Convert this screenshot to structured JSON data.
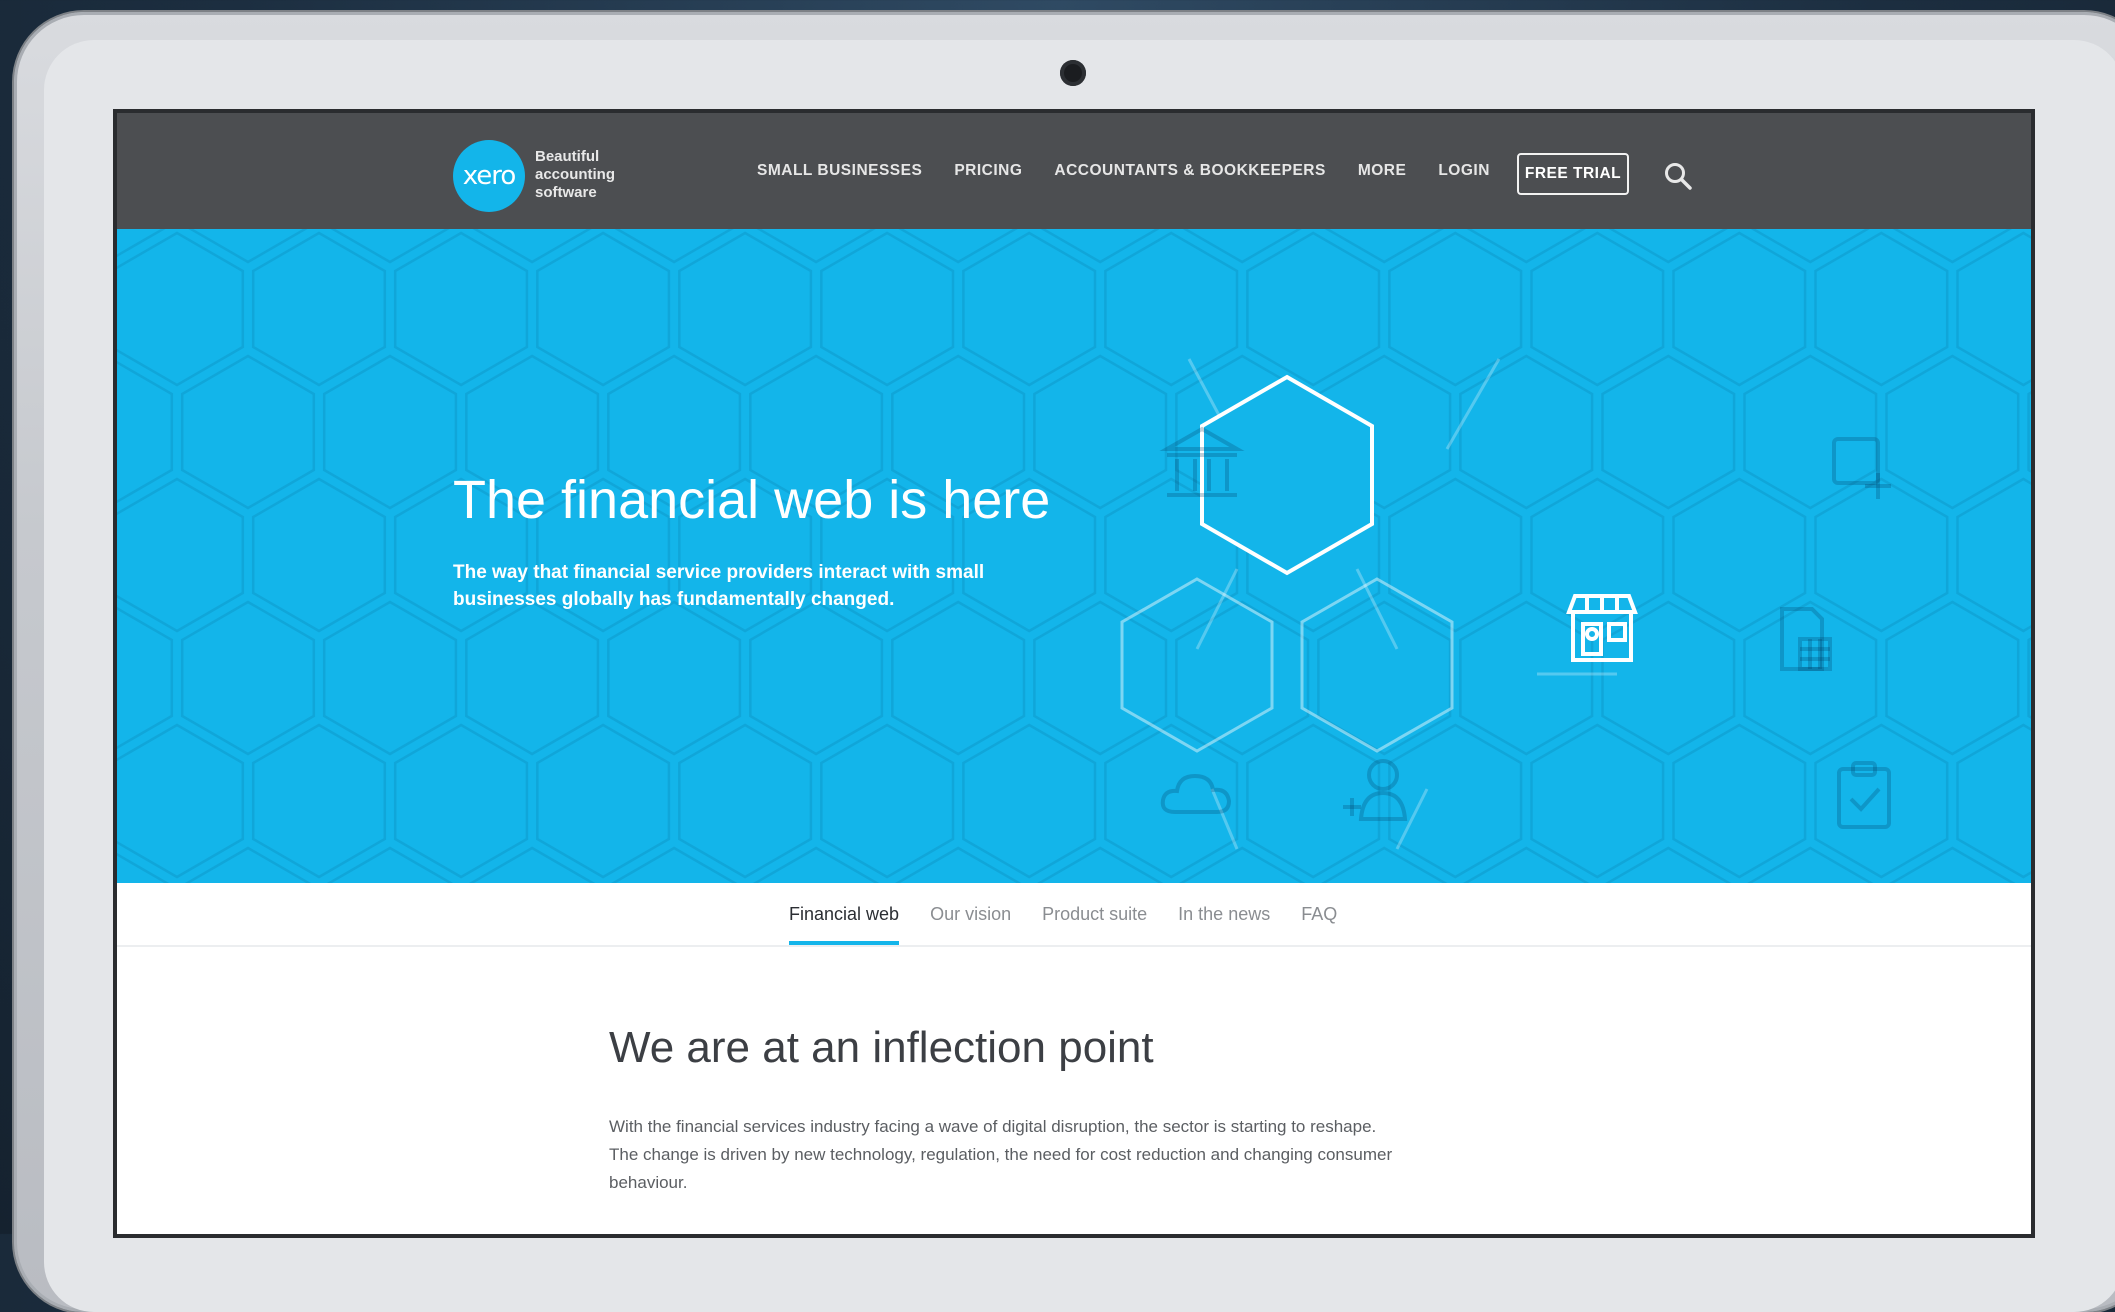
{
  "header": {
    "logo_text": "xero",
    "tagline": "Beautiful\naccounting\nsoftware",
    "nav": [
      "SMALL BUSINESSES",
      "PRICING",
      "ACCOUNTANTS & BOOKKEEPERS",
      "MORE",
      "LOGIN"
    ],
    "cta": "FREE TRIAL",
    "search_icon": "search-icon"
  },
  "hero": {
    "title": "The financial web is here",
    "subtitle": "The way that financial service providers interact with small businesses globally has fundamentally changed.",
    "icons": [
      "bank-icon",
      "storefront-icon",
      "document-plus-icon",
      "calculator-icon",
      "cloud-icon",
      "add-user-icon",
      "clipboard-check-icon",
      "report-icon"
    ]
  },
  "subnav": {
    "items": [
      "Financial web",
      "Our vision",
      "Product suite",
      "In the news",
      "FAQ"
    ],
    "active": "Financial web"
  },
  "section": {
    "title": "We are at an inflection point",
    "body": "With the financial services industry facing a wave of digital disruption, the sector is starting to reshape. The change is driven by new technology, regulation, the need for cost reduction and changing consumer behaviour."
  },
  "colors": {
    "brand_blue": "#13b5ea",
    "header_gray": "#4c4e51",
    "background_dark": "#1c2e40"
  }
}
